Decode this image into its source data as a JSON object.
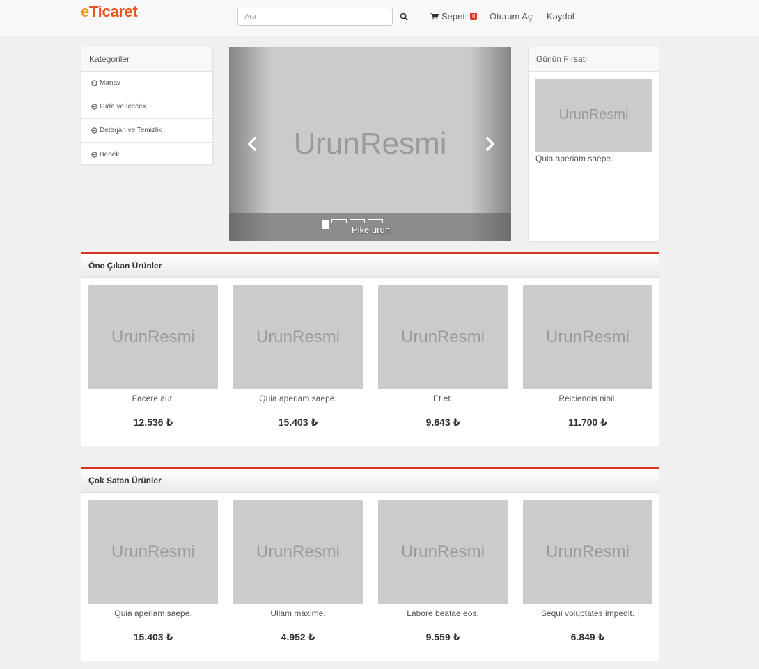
{
  "navbar": {
    "logo_first": "e",
    "logo_rest": "Ticaret",
    "search_placeholder": "Ara",
    "cart_label": "Sepet",
    "cart_count": "0",
    "login_label": "Oturum Aç",
    "register_label": "Kaydol"
  },
  "categories": {
    "title": "Kategoriler",
    "items": [
      "Manav",
      "Gıda ve İçecek",
      "Deterjan ve Temizlik",
      "Bebek"
    ]
  },
  "carousel": {
    "image_text": "UrunResmi",
    "caption": "Pike urun",
    "slide_count": 4,
    "active_index": 0
  },
  "deal": {
    "title": "Günün Fırsatı",
    "image_text": "UrunResmi",
    "product_name": "Quia aperiam saepe."
  },
  "featured": {
    "title": "Öne Çıkan Ürünler",
    "products": [
      {
        "image_text": "UrunResmi",
        "name": "Facere aut.",
        "price": "12.536 ₺"
      },
      {
        "image_text": "UrunResmi",
        "name": "Quia aperiam saepe.",
        "price": "15.403 ₺"
      },
      {
        "image_text": "UrunResmi",
        "name": "Et et.",
        "price": "9.643 ₺"
      },
      {
        "image_text": "UrunResmi",
        "name": "Reiciendis nihil.",
        "price": "11.700 ₺"
      }
    ]
  },
  "bestsellers": {
    "title": "Çok Satan Ürünler",
    "products": [
      {
        "image_text": "UrunResmi",
        "name": "Quia aperiam saepe.",
        "price": "15.403 ₺"
      },
      {
        "image_text": "UrunResmi",
        "name": "Ullam maxime.",
        "price": "4.952 ₺"
      },
      {
        "image_text": "UrunResmi",
        "name": "Labore beatae eos.",
        "price": "9.559 ₺"
      },
      {
        "image_text": "UrunResmi",
        "name": "Sequi voluptates impedit.",
        "price": "6.849 ₺"
      }
    ]
  },
  "colors": {
    "logo_e": "#f39c12",
    "logo_rest": "#e8541c",
    "section_accent": "#d9321e",
    "badge": "#e8321c",
    "placeholder_image": "#cbcbcb"
  },
  "icons": {
    "search": "search-icon",
    "cart": "shopping-cart-icon",
    "category": "circle-minus-icon",
    "carousel_prev": "chevron-left-icon",
    "carousel_next": "chevron-right-icon"
  }
}
